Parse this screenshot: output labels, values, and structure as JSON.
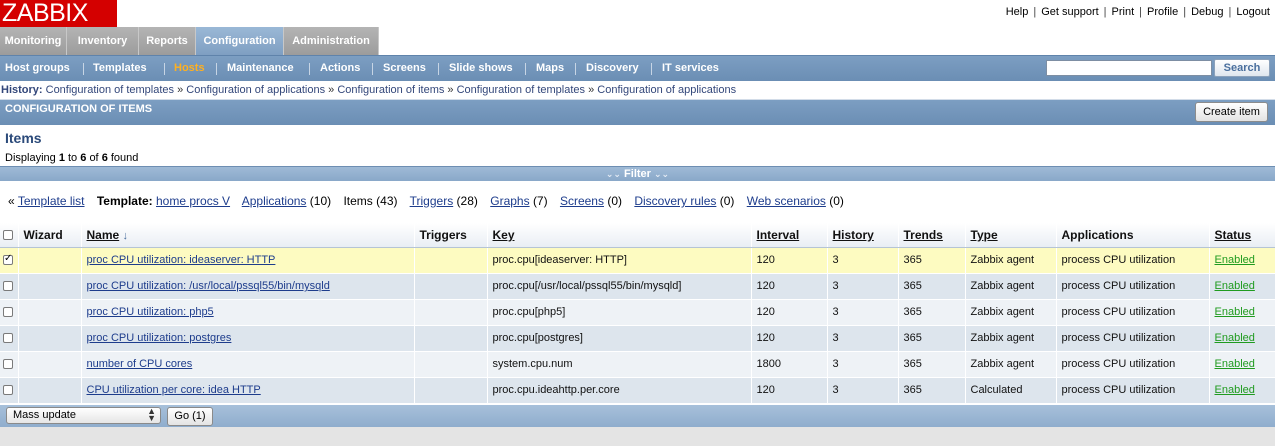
{
  "header": {
    "logo": "ZABBIX",
    "links": [
      "Help",
      "Get support",
      "Print",
      "Profile",
      "Debug",
      "Logout"
    ]
  },
  "main_menu": [
    "Monitoring",
    "Inventory",
    "Reports",
    "Configuration",
    "Administration"
  ],
  "main_menu_active": "Configuration",
  "sub_menu": [
    "Host groups",
    "Templates",
    "Hosts",
    "Maintenance",
    "Actions",
    "Screens",
    "Slide shows",
    "Maps",
    "Discovery",
    "IT services"
  ],
  "sub_menu_active": "Hosts",
  "search": {
    "value": "",
    "button": "Search"
  },
  "history": {
    "label": "History:",
    "items": [
      "Configuration of templates",
      "Configuration of applications",
      "Configuration of items",
      "Configuration of templates",
      "Configuration of applications"
    ],
    "separator": "»"
  },
  "section": {
    "title": "CONFIGURATION OF ITEMS",
    "create_button": "Create item"
  },
  "page_title": "Items",
  "displaying": {
    "prefix": "Displaying",
    "from": "1",
    "to_word": "to",
    "to": "6",
    "of_word": "of",
    "total": "6",
    "suffix": "found"
  },
  "filter": {
    "label": "Filter"
  },
  "template_nav": {
    "back_prefix": "«",
    "template_list": "Template list",
    "template_label": "Template:",
    "template_name": "home procs V",
    "applications": "Applications",
    "applications_count": "(10)",
    "items": "Items",
    "items_count": "(43)",
    "triggers": "Triggers",
    "triggers_count": "(28)",
    "graphs": "Graphs",
    "graphs_count": "(7)",
    "screens": "Screens",
    "screens_count": "(0)",
    "discovery": "Discovery rules",
    "discovery_count": "(0)",
    "web": "Web scenarios",
    "web_count": "(0)"
  },
  "table": {
    "columns": [
      "Wizard",
      "Name",
      "Triggers",
      "Key",
      "Interval",
      "History",
      "Trends",
      "Type",
      "Applications",
      "Status"
    ],
    "rows": [
      {
        "checked": true,
        "name": "proc CPU utilization: ideaserver: HTTP",
        "key": "proc.cpu[ideaserver: HTTP]",
        "interval": "120",
        "history": "3",
        "trends": "365",
        "type": "Zabbix agent",
        "applications": "process CPU utilization",
        "status": "Enabled"
      },
      {
        "checked": false,
        "name": "proc CPU utilization: /usr/local/pssql55/bin/mysqld",
        "key": "proc.cpu[/usr/local/pssql55/bin/mysqld]",
        "interval": "120",
        "history": "3",
        "trends": "365",
        "type": "Zabbix agent",
        "applications": "process CPU utilization",
        "status": "Enabled"
      },
      {
        "checked": false,
        "name": "proc CPU utilization: php5",
        "key": "proc.cpu[php5]",
        "interval": "120",
        "history": "3",
        "trends": "365",
        "type": "Zabbix agent",
        "applications": "process CPU utilization",
        "status": "Enabled"
      },
      {
        "checked": false,
        "name": "proc CPU utilization: postgres",
        "key": "proc.cpu[postgres]",
        "interval": "120",
        "history": "3",
        "trends": "365",
        "type": "Zabbix agent",
        "applications": "process CPU utilization",
        "status": "Enabled"
      },
      {
        "checked": false,
        "name": "number of CPU cores",
        "key": "system.cpu.num",
        "interval": "1800",
        "history": "3",
        "trends": "365",
        "type": "Zabbix agent",
        "applications": "process CPU utilization",
        "status": "Enabled"
      },
      {
        "checked": false,
        "name": "CPU utilization per core: idea HTTP",
        "key": "proc.cpu.ideahttp.per.core",
        "interval": "120",
        "history": "3",
        "trends": "365",
        "type": "Calculated",
        "applications": "process CPU utilization",
        "status": "Enabled"
      }
    ]
  },
  "footer": {
    "mass_action": "Mass update",
    "go_button": "Go (1)"
  }
}
